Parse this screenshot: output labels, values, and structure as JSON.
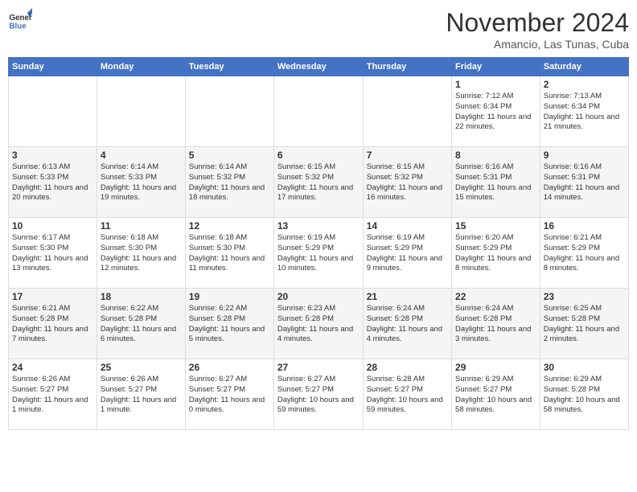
{
  "header": {
    "logo_general": "General",
    "logo_blue": "Blue",
    "month_title": "November 2024",
    "subtitle": "Amancio, Las Tunas, Cuba"
  },
  "columns": [
    "Sunday",
    "Monday",
    "Tuesday",
    "Wednesday",
    "Thursday",
    "Friday",
    "Saturday"
  ],
  "weeks": [
    [
      {
        "day": "",
        "info": ""
      },
      {
        "day": "",
        "info": ""
      },
      {
        "day": "",
        "info": ""
      },
      {
        "day": "",
        "info": ""
      },
      {
        "day": "",
        "info": ""
      },
      {
        "day": "1",
        "info": "Sunrise: 7:12 AM\nSunset: 6:34 PM\nDaylight: 11 hours and 22 minutes."
      },
      {
        "day": "2",
        "info": "Sunrise: 7:13 AM\nSunset: 6:34 PM\nDaylight: 11 hours and 21 minutes."
      }
    ],
    [
      {
        "day": "3",
        "info": "Sunrise: 6:13 AM\nSunset: 5:33 PM\nDaylight: 11 hours and 20 minutes."
      },
      {
        "day": "4",
        "info": "Sunrise: 6:14 AM\nSunset: 5:33 PM\nDaylight: 11 hours and 19 minutes."
      },
      {
        "day": "5",
        "info": "Sunrise: 6:14 AM\nSunset: 5:32 PM\nDaylight: 11 hours and 18 minutes."
      },
      {
        "day": "6",
        "info": "Sunrise: 6:15 AM\nSunset: 5:32 PM\nDaylight: 11 hours and 17 minutes."
      },
      {
        "day": "7",
        "info": "Sunrise: 6:15 AM\nSunset: 5:32 PM\nDaylight: 11 hours and 16 minutes."
      },
      {
        "day": "8",
        "info": "Sunrise: 6:16 AM\nSunset: 5:31 PM\nDaylight: 11 hours and 15 minutes."
      },
      {
        "day": "9",
        "info": "Sunrise: 6:16 AM\nSunset: 5:31 PM\nDaylight: 11 hours and 14 minutes."
      }
    ],
    [
      {
        "day": "10",
        "info": "Sunrise: 6:17 AM\nSunset: 5:30 PM\nDaylight: 11 hours and 13 minutes."
      },
      {
        "day": "11",
        "info": "Sunrise: 6:18 AM\nSunset: 5:30 PM\nDaylight: 11 hours and 12 minutes."
      },
      {
        "day": "12",
        "info": "Sunrise: 6:18 AM\nSunset: 5:30 PM\nDaylight: 11 hours and 11 minutes."
      },
      {
        "day": "13",
        "info": "Sunrise: 6:19 AM\nSunset: 5:29 PM\nDaylight: 11 hours and 10 minutes."
      },
      {
        "day": "14",
        "info": "Sunrise: 6:19 AM\nSunset: 5:29 PM\nDaylight: 11 hours and 9 minutes."
      },
      {
        "day": "15",
        "info": "Sunrise: 6:20 AM\nSunset: 5:29 PM\nDaylight: 11 hours and 8 minutes."
      },
      {
        "day": "16",
        "info": "Sunrise: 6:21 AM\nSunset: 5:29 PM\nDaylight: 11 hours and 8 minutes."
      }
    ],
    [
      {
        "day": "17",
        "info": "Sunrise: 6:21 AM\nSunset: 5:28 PM\nDaylight: 11 hours and 7 minutes."
      },
      {
        "day": "18",
        "info": "Sunrise: 6:22 AM\nSunset: 5:28 PM\nDaylight: 11 hours and 6 minutes."
      },
      {
        "day": "19",
        "info": "Sunrise: 6:22 AM\nSunset: 5:28 PM\nDaylight: 11 hours and 5 minutes."
      },
      {
        "day": "20",
        "info": "Sunrise: 6:23 AM\nSunset: 5:28 PM\nDaylight: 11 hours and 4 minutes."
      },
      {
        "day": "21",
        "info": "Sunrise: 6:24 AM\nSunset: 5:28 PM\nDaylight: 11 hours and 4 minutes."
      },
      {
        "day": "22",
        "info": "Sunrise: 6:24 AM\nSunset: 5:28 PM\nDaylight: 11 hours and 3 minutes."
      },
      {
        "day": "23",
        "info": "Sunrise: 6:25 AM\nSunset: 5:28 PM\nDaylight: 11 hours and 2 minutes."
      }
    ],
    [
      {
        "day": "24",
        "info": "Sunrise: 6:26 AM\nSunset: 5:27 PM\nDaylight: 11 hours and 1 minute."
      },
      {
        "day": "25",
        "info": "Sunrise: 6:26 AM\nSunset: 5:27 PM\nDaylight: 11 hours and 1 minute."
      },
      {
        "day": "26",
        "info": "Sunrise: 6:27 AM\nSunset: 5:27 PM\nDaylight: 11 hours and 0 minutes."
      },
      {
        "day": "27",
        "info": "Sunrise: 6:27 AM\nSunset: 5:27 PM\nDaylight: 10 hours and 59 minutes."
      },
      {
        "day": "28",
        "info": "Sunrise: 6:28 AM\nSunset: 5:27 PM\nDaylight: 10 hours and 59 minutes."
      },
      {
        "day": "29",
        "info": "Sunrise: 6:29 AM\nSunset: 5:27 PM\nDaylight: 10 hours and 58 minutes."
      },
      {
        "day": "30",
        "info": "Sunrise: 6:29 AM\nSunset: 5:28 PM\nDaylight: 10 hours and 58 minutes."
      }
    ]
  ]
}
